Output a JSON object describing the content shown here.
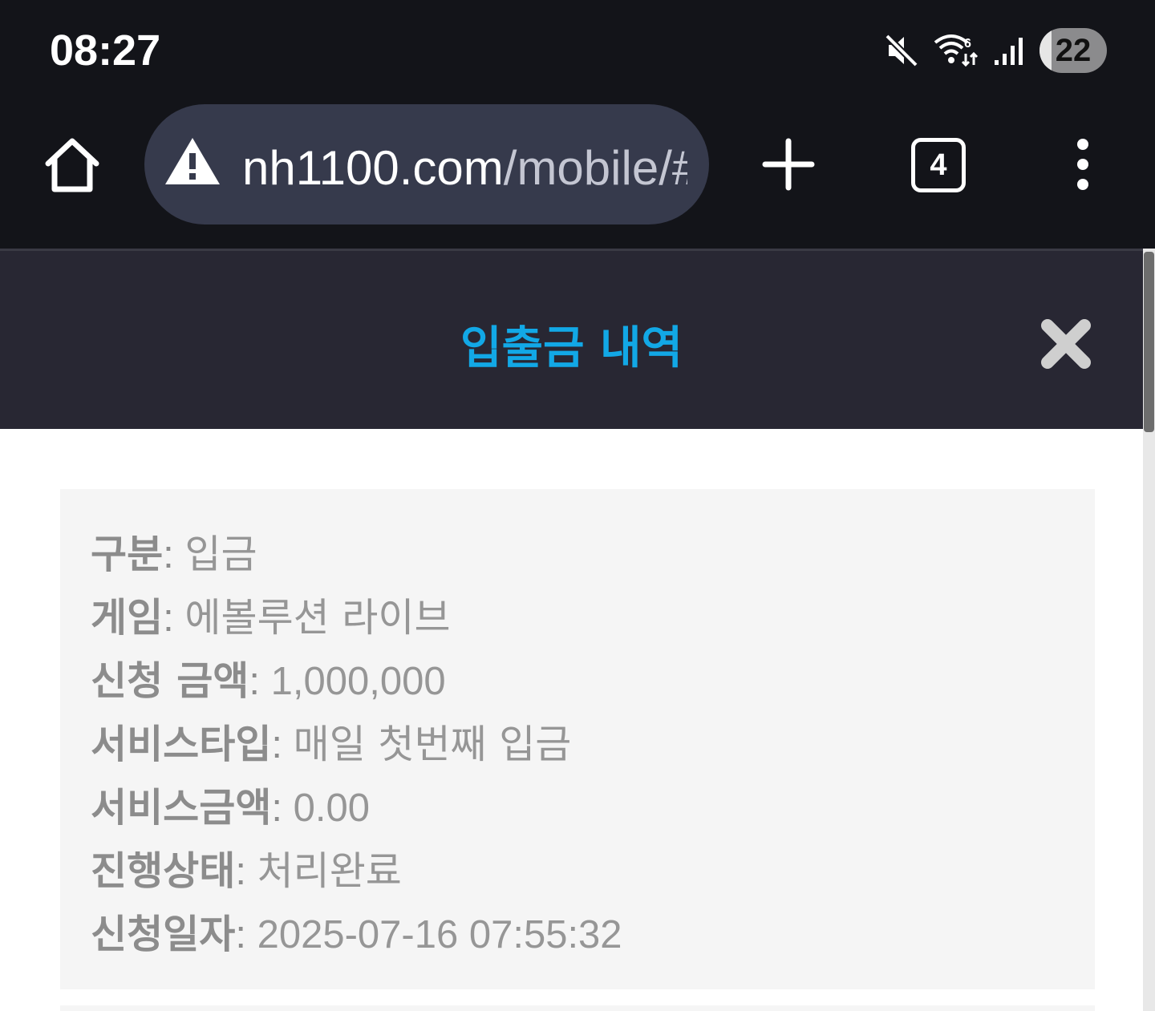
{
  "status_bar": {
    "time": "08:27",
    "battery_level": "22",
    "icons": [
      "mute-icon",
      "wifi-icon",
      "signal-icon"
    ]
  },
  "browser": {
    "url_domain": "nh1100.com",
    "url_path": "/mobile/#",
    "tab_count": "4",
    "icons": [
      "home-icon",
      "warning-icon",
      "plus-icon",
      "more-vert-icon"
    ]
  },
  "modal": {
    "title": "입출금 내역",
    "title_color": "#12a8e6",
    "close_icon": "close-x-icon"
  },
  "record": {
    "separator": ": ",
    "fields": [
      {
        "label": "구분",
        "value": "입금"
      },
      {
        "label": "게임",
        "value": "에볼루션 라이브"
      },
      {
        "label": "신청 금액",
        "value": "1,000,000"
      },
      {
        "label": "서비스타입",
        "value": "매일 첫번째 입금"
      },
      {
        "label": "서비스금액",
        "value": "0.00"
      },
      {
        "label": "진행상태",
        "value": "처리완료"
      },
      {
        "label": "신청일자",
        "value": "2025-07-16 07:55:32"
      }
    ]
  }
}
